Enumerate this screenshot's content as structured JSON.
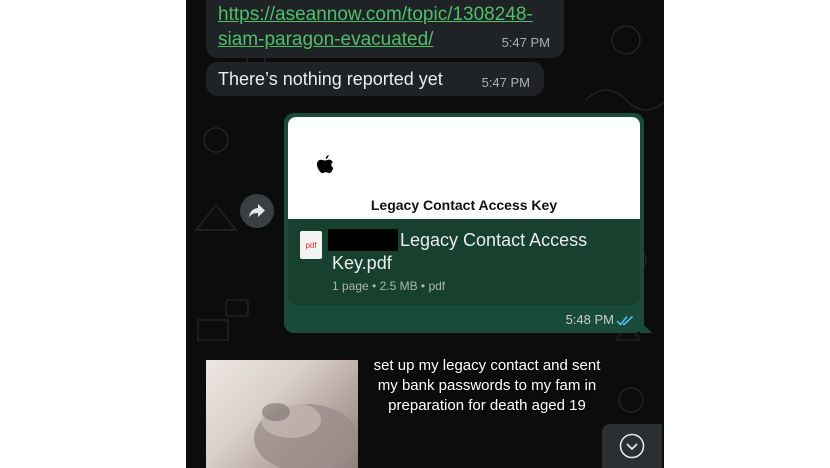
{
  "messages": {
    "link_message": {
      "url_text": "https://aseannow.com/topic/1308248-siam-paragon-evacuated/",
      "time": "5:47 PM"
    },
    "text_message": {
      "text": "There’s nothing reported yet",
      "time": "5:47 PM"
    },
    "document_message": {
      "preview_title": "Legacy Contact Access Key",
      "file_name": "Legacy Contact Access Key.pdf",
      "file_type_label": "pdf",
      "meta": "1 page • 2.5 MB • pdf",
      "time": "5:48 PM",
      "status": "read"
    }
  },
  "video_caption": "set up my legacy contact and sent my bank passwords to my fam in preparation for death aged 19",
  "icons": [
    "forward-icon",
    "apple-logo-icon",
    "pdf-file-icon",
    "double-check-icon",
    "chevron-down-icon"
  ],
  "colors": {
    "chat_background": "#0c0c0c",
    "incoming_bubble": "#1f2326",
    "outgoing_bubble": "#1a4a3a",
    "link_color": "#4fbf6a",
    "read_ticks": "#53bdeb"
  }
}
